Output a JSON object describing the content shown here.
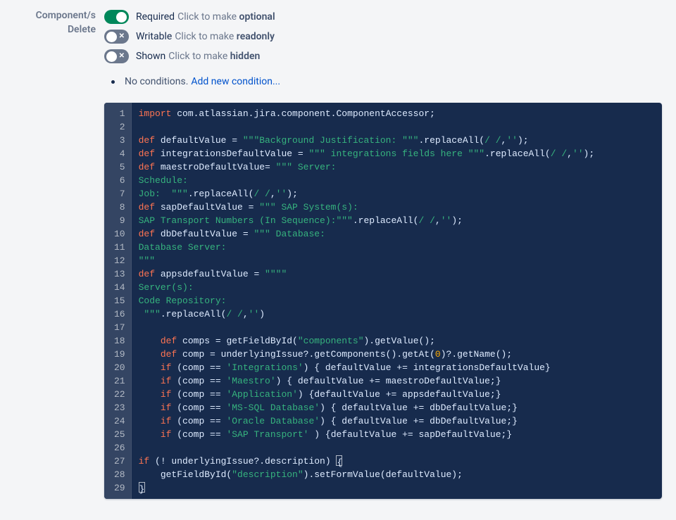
{
  "field_labels": {
    "line1": "Component/s",
    "line2": "Delete"
  },
  "toggles": {
    "required": {
      "label": "Required",
      "hint_prefix": "Click to make ",
      "hint_bold": "optional"
    },
    "writable": {
      "label": "Writable",
      "hint_prefix": "Click to make ",
      "hint_bold": "readonly"
    },
    "shown": {
      "label": "Shown",
      "hint_prefix": "Click to make ",
      "hint_bold": "hidden"
    }
  },
  "conditions": {
    "text": "No conditions.",
    "link": "Add new condition..."
  },
  "code": {
    "lines": [
      "import com.atlassian.jira.component.ComponentAccessor;",
      "",
      "def defaultValue = \"\"\"Background Justification: \"\"\".replaceAll(/ /,'');",
      "def integrationsDefaultValue = \"\"\" integrations fields here \"\"\".replaceAll(/ /,'');",
      "def maestroDefaultValue= \"\"\" Server:",
      "Schedule:",
      "Job:  \"\"\".replaceAll(/ /,'');",
      "def sapDefaultValue = \"\"\" SAP System(s):",
      "SAP Transport Numbers (In Sequence):\"\"\".replaceAll(/ /,'');",
      "def dbDefaultValue = \"\"\" Database:",
      "Database Server:",
      "\"\"\"",
      "def appsdefaultValue = \"\"\"\"",
      "Server(s):",
      "Code Repository:",
      " \"\"\".replaceAll(/ /,'')",
      "",
      "    def comps = getFieldById(\"components\").getValue();",
      "    def comp = underlyingIssue?.getComponents().getAt(0)?.getName();",
      "    if (comp == 'Integrations') { defaultValue += integrationsDefaultValue}",
      "    if (comp == 'Maestro') { defaultValue += maestroDefaultValue;}",
      "    if (comp == 'Application') {defaultValue += appsdefaultValue;}",
      "    if (comp == 'MS-SQL Database') { defaultValue += dbDefaultValue;}",
      "    if (comp == 'Oracle Database') { defaultValue += dbDefaultValue;}",
      "    if (comp == 'SAP Transport' ) {defaultValue += sapDefaultValue;}",
      "",
      "if (! underlyingIssue?.description) {",
      "    getFieldById(\"description\").setFormValue(defaultValue);",
      "}"
    ]
  }
}
